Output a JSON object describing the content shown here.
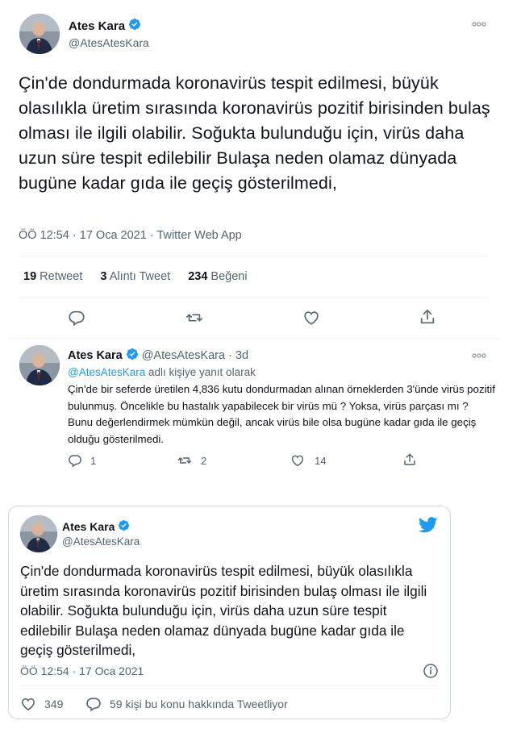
{
  "main_tweet": {
    "author_name": "Ates Kara",
    "handle": "@AtesAtesKara",
    "text": "Çin'de dondurmada koronavirüs tespit edilmesi, büyük olasılıkla üretim sırasında koronavirüs pozitif birisinden bulaş olması ile ilgili olabilir. Soğukta bulunduğu için, virüs  daha uzun süre tespit edilebilir Bulaşa neden olamaz dünyada bugüne kadar gıda ile geçiş gösterilmedi,",
    "timestamp": "ÖÖ 12:54 · 17 Oca 2021 · Twitter Web App",
    "stats": {
      "retweets_count": "19",
      "retweets_label": "Retweet",
      "quotes_count": "3",
      "quotes_label": "Alıntı Tweet",
      "likes_count": "234",
      "likes_label": "Beğeni"
    }
  },
  "reply_tweet": {
    "author_name": "Ates Kara",
    "handle": "@AtesAtesKara",
    "time": "· 3d",
    "reply_to_handle": "@AtesAtesKara",
    "reply_to_suffix": "adlı kişiye yanıt olarak",
    "text": "Çin'de bir seferde üretilen 4,836 kutu dondurmadan alınan örneklerden 3'ünde virüs pozitif bulunmuş. Öncelikle bu hastalık yapabilecek bir virüs mü ? Yoksa, virüs parçası mı ? Bunu değerlendirmek mümkün değil, ancak virüs bile olsa bugüne kadar gıda ile geçiş olduğu gösterilmedi.",
    "reply_count": "1",
    "retweet_count": "2",
    "like_count": "14"
  },
  "embedded_tweet": {
    "author_name": "Ates Kara",
    "handle": "@AtesAtesKara",
    "text": "Çin'de dondurmada koronavirüs tespit edilmesi, büyük olasılıkla üretim sırasında koronavirüs pozitif birisinden bulaş olması ile ilgili olabilir. Soğukta bulunduğu için, virüs  daha uzun süre tespit edilebilir Bulaşa neden olamaz dünyada bugüne kadar gıda ile geçiş gösterilmedi,",
    "timestamp": "ÖÖ 12:54 · 17 Oca 2021",
    "like_count": "349",
    "discussion_label": "59 kişi bu konu hakkında Tweetliyor"
  },
  "colors": {
    "brand_blue": "#1d9bf0",
    "text_primary": "#0f1419",
    "text_secondary": "#536471",
    "divider": "#eff3f4"
  },
  "icons": [
    "verified-badge-icon",
    "more-icon",
    "reply-icon",
    "retweet-icon",
    "like-icon",
    "share-icon",
    "twitter-bird-icon",
    "info-icon"
  ]
}
